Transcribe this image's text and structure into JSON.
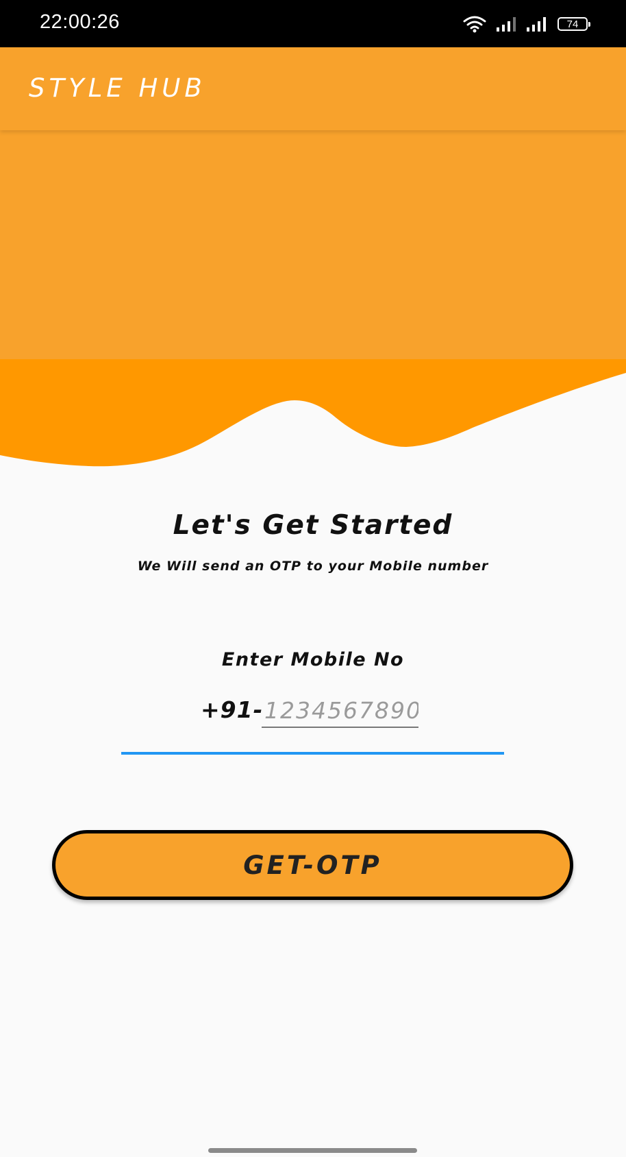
{
  "status_bar": {
    "time": "22:00:26",
    "battery": "74",
    "icons": [
      "wifi-icon",
      "signal-icon",
      "signal-icon",
      "battery-icon"
    ]
  },
  "app_bar": {
    "title": "STYLE HUB"
  },
  "content": {
    "headline": "Let's Get Started",
    "subline": "We Will send an OTP to your Mobile number",
    "mobile_label": "Enter Mobile No",
    "country_prefix": "+91-",
    "phone_placeholder": "1234567890",
    "button_label": "GET-OTP"
  },
  "colors": {
    "brand": "#f8a22c",
    "wave": "#ff9800",
    "accent": "#2196f3",
    "background": "#fafafa"
  }
}
